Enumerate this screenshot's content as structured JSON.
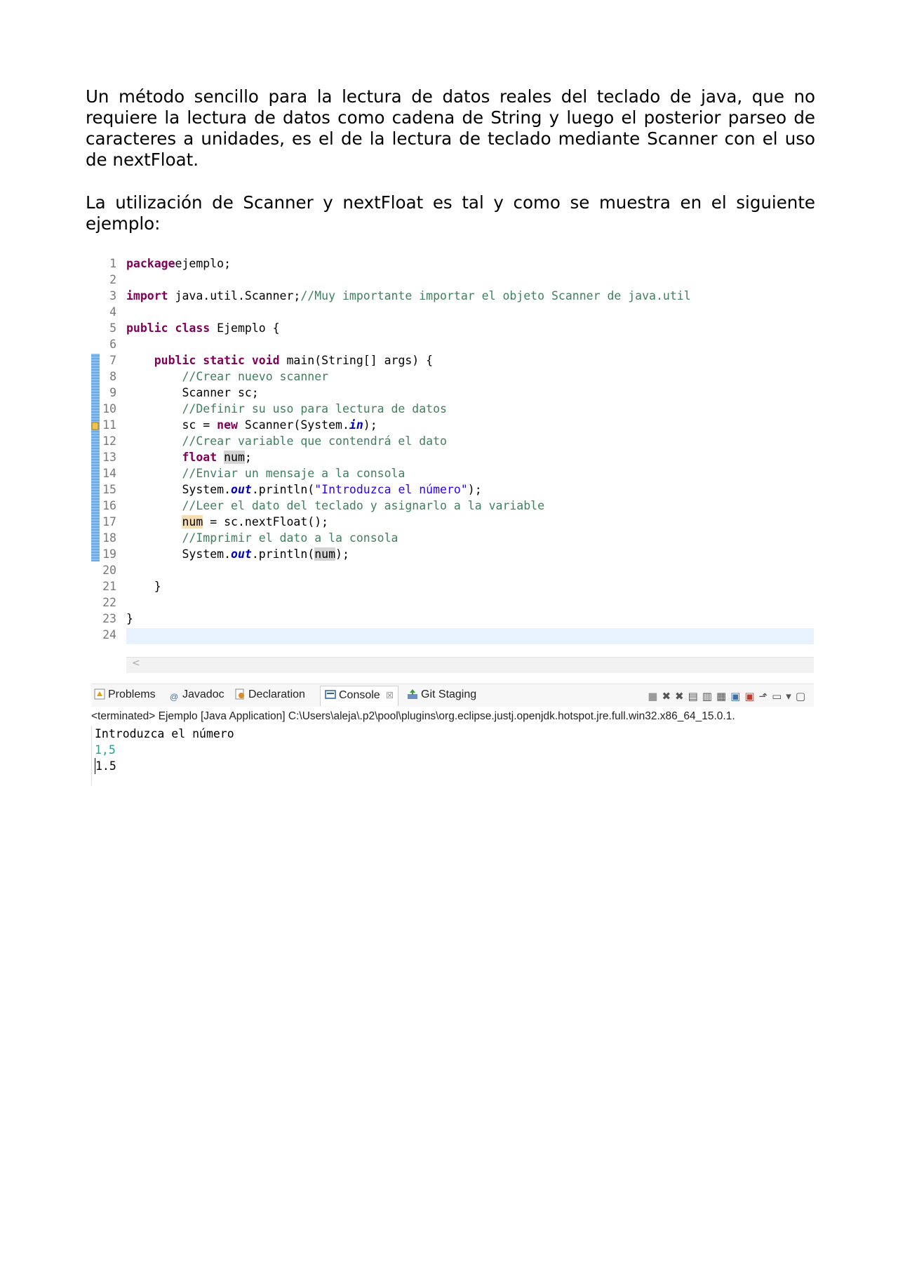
{
  "paragraphs": [
    "Un método sencillo para la lectura de datos reales del teclado de java, que no requiere la lectura de datos como cadena de String y luego el posterior parseo de caracteres a unidades, es el de la lectura de teclado mediante Scanner con el uso de nextFloat.",
    "La utilización de Scanner y nextFloat es tal y como se muestra en el siguiente ejemplo:"
  ],
  "editor": {
    "lines": [
      {
        "n": "1",
        "code": [
          [
            "kw",
            "package"
          ],
          [
            "",
            "ejemplo;"
          ]
        ]
      },
      {
        "n": "2",
        "code": []
      },
      {
        "n": "3",
        "code": [
          [
            "kw",
            "import"
          ],
          [
            "",
            " java.util.Scanner;"
          ],
          [
            "cm",
            "//Muy importante importar el objeto Scanner de java.util"
          ]
        ]
      },
      {
        "n": "4",
        "code": []
      },
      {
        "n": "5",
        "code": [
          [
            "kw",
            "public class"
          ],
          [
            "",
            " Ejemplo {"
          ]
        ]
      },
      {
        "n": "6",
        "code": []
      },
      {
        "n": "7",
        "code": [
          [
            "",
            "    "
          ],
          [
            "kw",
            "public static void"
          ],
          [
            "",
            " main(String[] args) {"
          ]
        ]
      },
      {
        "n": "8",
        "code": [
          [
            "",
            "        "
          ],
          [
            "cm",
            "//Crear nuevo scanner"
          ]
        ]
      },
      {
        "n": "9",
        "code": [
          [
            "",
            "        Scanner sc;"
          ]
        ]
      },
      {
        "n": "10",
        "code": [
          [
            "",
            "        "
          ],
          [
            "cm",
            "//Definir su uso para lectura de datos"
          ]
        ]
      },
      {
        "n": "11",
        "code": [
          [
            "",
            "        sc = "
          ],
          [
            "kw",
            "new"
          ],
          [
            "",
            " Scanner(System."
          ],
          [
            "fld",
            "in"
          ],
          [
            "",
            ");"
          ]
        ]
      },
      {
        "n": "12",
        "code": [
          [
            "",
            "        "
          ],
          [
            "cm",
            "//Crear variable que contendrá el dato"
          ]
        ]
      },
      {
        "n": "13",
        "code": [
          [
            "",
            "        "
          ],
          [
            "kw",
            "float"
          ],
          [
            "",
            " "
          ],
          [
            "hl-grey",
            "num"
          ],
          [
            "",
            ";"
          ]
        ]
      },
      {
        "n": "14",
        "code": [
          [
            "",
            "        "
          ],
          [
            "cm",
            "//Enviar un mensaje a la consola"
          ]
        ]
      },
      {
        "n": "15",
        "code": [
          [
            "",
            "        System."
          ],
          [
            "fld",
            "out"
          ],
          [
            "",
            ".println("
          ],
          [
            "st",
            "\"Introduzca el número\""
          ],
          [
            "",
            ");"
          ]
        ]
      },
      {
        "n": "16",
        "code": [
          [
            "",
            "        "
          ],
          [
            "cm",
            "//Leer el dato del teclado y asignarlo a la variable"
          ]
        ]
      },
      {
        "n": "17",
        "code": [
          [
            "",
            "        "
          ],
          [
            "hl-orange",
            "num"
          ],
          [
            "",
            " = sc.nextFloat();"
          ]
        ]
      },
      {
        "n": "18",
        "code": [
          [
            "",
            "        "
          ],
          [
            "cm",
            "//Imprimir el dato a la consola"
          ]
        ]
      },
      {
        "n": "19",
        "code": [
          [
            "",
            "        System."
          ],
          [
            "fld",
            "out"
          ],
          [
            "",
            ".println("
          ],
          [
            "hl-grey",
            "num"
          ],
          [
            "",
            ");"
          ]
        ]
      },
      {
        "n": "20",
        "code": []
      },
      {
        "n": "21",
        "code": [
          [
            "",
            "    }"
          ]
        ]
      },
      {
        "n": "22",
        "code": []
      },
      {
        "n": "23",
        "code": [
          [
            "",
            "}"
          ]
        ]
      },
      {
        "n": "24",
        "code": []
      }
    ]
  },
  "tabs": {
    "problems": "Problems",
    "javadoc": "Javadoc",
    "declaration": "Declaration",
    "console": "Console",
    "console_close": "☒",
    "git_staging": "Git Staging"
  },
  "console": {
    "header": "<terminated> Ejemplo [Java Application] C:\\Users\\aleja\\.p2\\pool\\plugins\\org.eclipse.justj.openjdk.hotspot.jre.full.win32.x86_64_15.0.1.",
    "prompt": "Introduzca el número",
    "input": "1,5",
    "output": "1.5"
  },
  "colors": {
    "keyword": "#7f0055",
    "comment": "#3f7f5f",
    "string": "#2a00ff",
    "field": "#0000c0",
    "console_input": "#25a18e"
  }
}
